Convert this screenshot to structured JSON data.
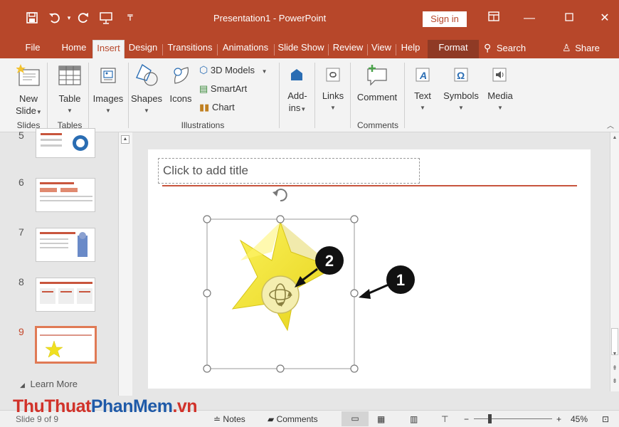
{
  "titlebar": {
    "doc_title": "Presentation1  -  PowerPoint",
    "sign_in": "Sign in"
  },
  "tabs": [
    {
      "label": "File"
    },
    {
      "label": "Home"
    },
    {
      "label": "Insert"
    },
    {
      "label": "Design"
    },
    {
      "label": "Transitions"
    },
    {
      "label": "Animations"
    },
    {
      "label": "Slide Show"
    },
    {
      "label": "Review"
    },
    {
      "label": "View"
    },
    {
      "label": "Help"
    },
    {
      "label": "Format"
    }
  ],
  "tell_me": "Search",
  "share": "Share",
  "ribbon": {
    "new_slide": "New",
    "new_slide_2": "Slide",
    "table": "Table",
    "images": "Images",
    "shapes": "Shapes",
    "icons": "Icons",
    "models_3d": "3D Models",
    "smartart": "SmartArt",
    "chart": "Chart",
    "addins": "Add-",
    "addins_2": "ins",
    "links": "Links",
    "comment": "Comment",
    "text": "Text",
    "symbols": "Symbols",
    "media": "Media",
    "groups": {
      "slides": "Slides",
      "tables": "Tables",
      "illustrations": "Illustrations",
      "comments": "Comments"
    }
  },
  "thumbnails": {
    "items": [
      {
        "num": "6"
      },
      {
        "num": "7"
      },
      {
        "num": "8"
      },
      {
        "num": "9"
      }
    ],
    "partial_num": "5",
    "learn_more": "Learn More"
  },
  "slide": {
    "title_placeholder": "Click to add title"
  },
  "callouts": {
    "one": "1",
    "two": "2"
  },
  "statusbar": {
    "slide_info": "Slide 9 of 9",
    "notes": "Notes",
    "comments": "Comments",
    "zoom": "45%"
  },
  "watermark": {
    "part1": "ThuThuat",
    "part2": "PhanMem",
    "part3": ".vn"
  },
  "colors": {
    "accent": "#b7472a",
    "star": "#f0e020",
    "selection": "#e07a55"
  }
}
